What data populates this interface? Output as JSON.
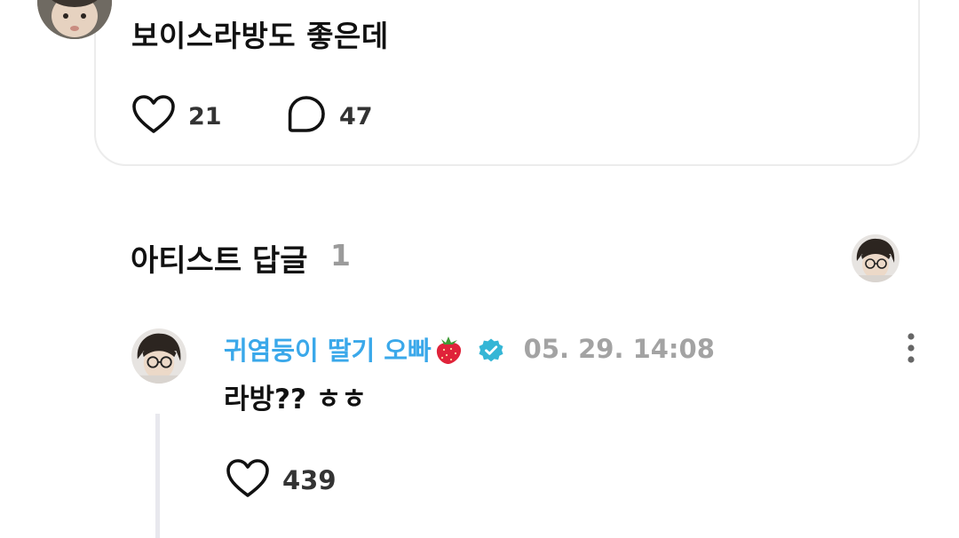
{
  "post": {
    "text": "보이스라방도 좋은데",
    "likes": "21",
    "comments": "47"
  },
  "artist_replies": {
    "title": "아티스트 답글",
    "count": "1"
  },
  "reply": {
    "author": "귀염둥이 딸기 오빠",
    "author_emoji": "strawberry-icon",
    "verified": "verified-badge-icon",
    "time": "05. 29. 14:08",
    "text": "라방?? ㅎㅎ",
    "likes": "439"
  },
  "colors": {
    "author_name": "#3aa8ea",
    "verified_badge": "#35b6d6",
    "timestamp": "#a3a3a3",
    "count_muted": "#9b9b9b",
    "card_border": "#ececec",
    "thread_line": "#e8e8ee"
  }
}
